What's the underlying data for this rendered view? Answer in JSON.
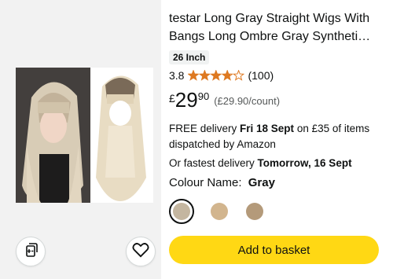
{
  "product": {
    "title": "testar Long Gray Straight Wigs With Bangs Long Ombre Gray Syntheti…",
    "size_label": "26 Inch",
    "rating_value": "3.8",
    "rating_stars": 3.8,
    "review_count": "(100)",
    "price_symbol": "£",
    "price_whole": "29",
    "price_fraction": "90",
    "unit_price": "(£29.90/count)"
  },
  "delivery": {
    "free_prefix": "FREE delivery ",
    "free_date": "Fri 18 Sept",
    "free_suffix": " on £35 of items dispatched by Amazon",
    "fastest_prefix": "Or fastest delivery ",
    "fastest_date": "Tomorrow, 16 Sept"
  },
  "colour": {
    "label": "Colour Name:",
    "value": "Gray",
    "swatches": [
      {
        "color": "#c4b6a0",
        "selected": true
      },
      {
        "color": "#d2b58e",
        "selected": false
      },
      {
        "color": "#b49a7a",
        "selected": false
      }
    ]
  },
  "actions": {
    "add_to_basket": "Add to basket"
  },
  "colors": {
    "basket_button": "#ffd814",
    "star": "#de7921",
    "image_panel_bg": "#f2f2f2"
  },
  "icons": {
    "compare": "compare-cards-icon",
    "wishlist": "heart-icon",
    "star": "star-icon"
  }
}
